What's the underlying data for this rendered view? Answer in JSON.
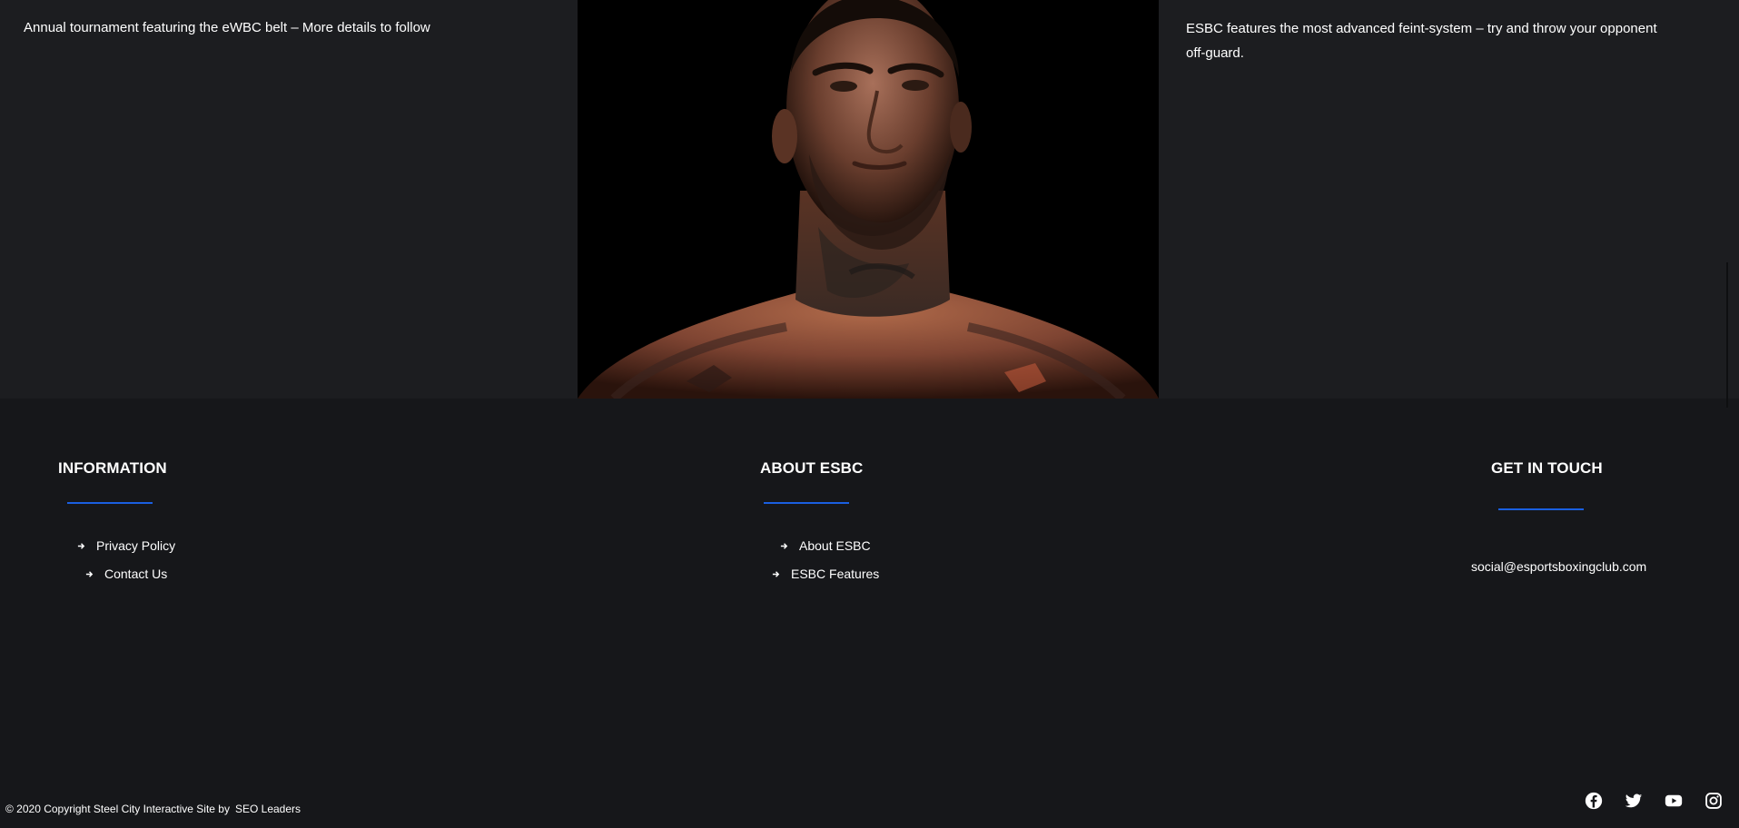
{
  "features": {
    "left_text": "Annual tournament featuring the eWBC belt – More details to follow",
    "right_text": "ESBC features the most advanced feint-system – try and throw your opponent off-guard."
  },
  "portrait": {
    "icon": "boxer-portrait-image"
  },
  "footer": {
    "information": {
      "heading": "INFORMATION",
      "links": [
        "Privacy Policy",
        "Contact Us"
      ]
    },
    "about": {
      "heading": "ABOUT ESBC",
      "links": [
        "About ESBC",
        "ESBC Features"
      ]
    },
    "contact": {
      "heading": "GET IN TOUCH",
      "email": "social@esportsboxingclub.com"
    },
    "copyright": "© 2020 Copyright Steel City Interactive Site by",
    "credit_link": "SEO Leaders",
    "socials": [
      "facebook-icon",
      "twitter-icon",
      "youtube-icon",
      "instagram-icon"
    ]
  },
  "colors": {
    "band_bg": "#1c1d20",
    "footer_bg": "#16171a",
    "accent": "#1a5fe0",
    "text": "#ffffff"
  }
}
